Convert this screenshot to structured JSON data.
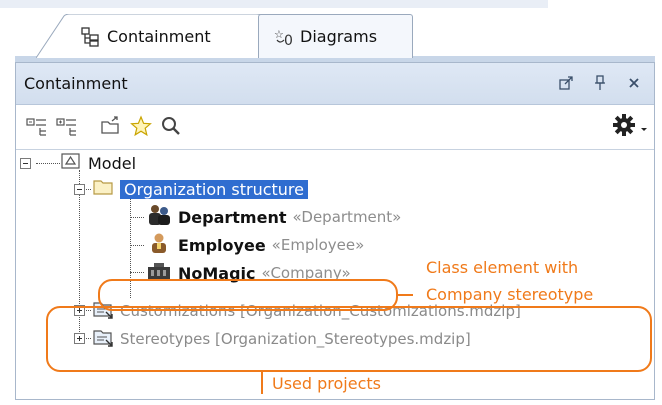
{
  "tabs": [
    {
      "label": "Containment",
      "icon": "containment-tree-icon",
      "active": true
    },
    {
      "label": "Diagrams",
      "icon": "diagrams-icon",
      "active": false
    }
  ],
  "panel": {
    "title": "Containment",
    "controls": [
      "undock-icon",
      "pin-icon",
      "close-icon"
    ]
  },
  "toolbar": {
    "buttons": [
      "collapse-all-icon",
      "expand-all-icon",
      "open-folder-icon",
      "favorites-star-icon",
      "search-icon"
    ],
    "options": "gear-icon"
  },
  "tree": {
    "model": {
      "label": "Model"
    },
    "org": {
      "label": "Organization structure"
    },
    "department": {
      "label": "Department",
      "stereotype": "«Department»"
    },
    "employee": {
      "label": "Employee",
      "stereotype": "«Employee»"
    },
    "nomagic": {
      "label": "NoMagic",
      "stereotype": "«Company»"
    },
    "customizations": {
      "label": "Customizations [Organization_Customizations.mdzip]"
    },
    "stereotypes": {
      "label": "Stereotypes [Organization_Stereotypes.mdzip]"
    }
  },
  "annotations": {
    "class_element_line1": "Class element with",
    "class_element_line2": "Company stereotype",
    "used_projects": "Used projects"
  },
  "colors": {
    "accent": "#f07a1a",
    "selection": "#2f6dd0",
    "header": "#d9e4f2"
  }
}
